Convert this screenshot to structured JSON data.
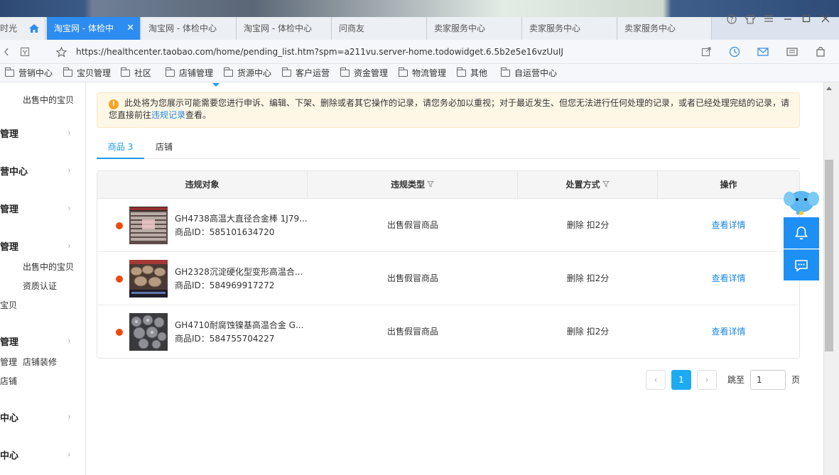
{
  "browser": {
    "partial_tab": "时光",
    "tabs": [
      {
        "label": "淘宝网 - 体检中",
        "active": true
      },
      {
        "label": "淘宝网 - 体检中心"
      },
      {
        "label": "淘宝网 - 体检中心"
      },
      {
        "label": "问商友"
      },
      {
        "label": "卖家服务中心"
      },
      {
        "label": "卖家服务中心"
      },
      {
        "label": "卖家服务中心"
      }
    ],
    "tab_close": "✕",
    "url": "https://healthcenter.taobao.com/home/pending_list.htm?spm=a211vu.server-home.todowidget.6.5b2e5e16vzUuIJ",
    "bookmarks": [
      "营销中心",
      "宝贝管理",
      "社区",
      "店铺管理",
      "货源中心",
      "客户运营",
      "资金管理",
      "物流管理",
      "其他",
      "自运营中心"
    ],
    "window_controls": {
      "help": "?",
      "minimize": "—",
      "maximize": "☐",
      "close": "✕"
    }
  },
  "sidebar": {
    "items": [
      {
        "text": "出售中的宝贝",
        "type": "sub"
      },
      {
        "text": "管理",
        "type": "head"
      },
      {
        "text": "营中心",
        "type": "head"
      },
      {
        "text": "管理",
        "type": "head"
      },
      {
        "text": "管理",
        "type": "head"
      },
      {
        "text": "出售中的宝贝",
        "type": "sub"
      },
      {
        "text": "资质认证",
        "type": "sub"
      },
      {
        "text": "宝贝",
        "type": "sub"
      },
      {
        "text": "管理",
        "type": "head"
      },
      {
        "text": "管理",
        "type": "sub"
      },
      {
        "text": "店铺装修",
        "type": "sub"
      },
      {
        "text": "店铺",
        "type": "sub"
      },
      {
        "text": "中心",
        "type": "head"
      },
      {
        "text": "中心",
        "type": "head"
      }
    ],
    "chevron": "›"
  },
  "notice": {
    "text_before": "此处将为您展示可能需要您进行申诉、编辑、下架、删除或者其它操作的记录，请您务必加以重视；对于最近发生、但您无法进行任何处理的记录，或者已经处理完结的记录，请您直接前往",
    "link": "违规记录",
    "text_after": "查看。",
    "icon": "!"
  },
  "content_tabs": [
    {
      "label": "商品 3",
      "active": true
    },
    {
      "label": "店铺",
      "active": false
    }
  ],
  "table": {
    "headers": [
      "违规对象",
      "违规类型",
      "处置方式",
      "操作"
    ],
    "rows": [
      {
        "title": "GH4738高温大直径合金棒 1J79...",
        "product_id": "商品ID：585101634720",
        "violation_type": "出售假冒商品",
        "penalty": "删除 扣2分",
        "action": "查看详情"
      },
      {
        "title": "GH2328沉淀硬化型变形高温合...",
        "product_id": "商品ID：584969917272",
        "violation_type": "出售假冒商品",
        "penalty": "删除 扣2分",
        "action": "查看详情"
      },
      {
        "title": "GH4710耐腐蚀镍基高温合金 G...",
        "product_id": "商品ID：584755704227",
        "violation_type": "出售假冒商品",
        "penalty": "删除 扣2分",
        "action": "查看详情"
      }
    ]
  },
  "pagination": {
    "prev": "‹",
    "current": "1",
    "next": "›",
    "jump_label": "跳至",
    "jump_value": "1",
    "suffix": "页"
  },
  "colors": {
    "accent": "#1e9be8",
    "active_tab": "#2d8cf0",
    "danger_dot": "#f0490c",
    "notice_bg": "#fff7e6",
    "float_button": "#1e8ff4"
  }
}
